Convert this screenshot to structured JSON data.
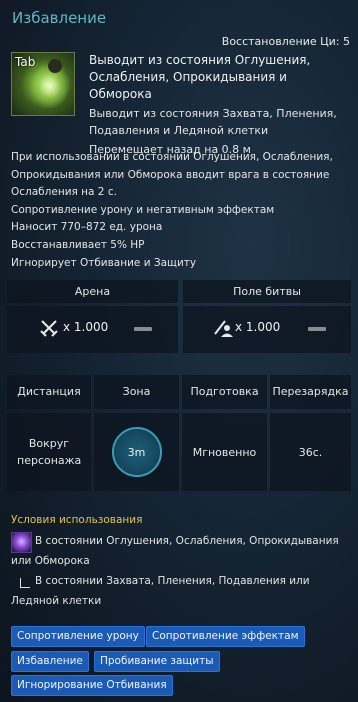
{
  "skill": {
    "title": "Избавление",
    "recovery": "Восстановление Ци: 5",
    "hotkey": "Tab",
    "icon": "skill-escape-icon",
    "main_effect": "Выводит из состояния Оглушения, Ослабления, Опрокидывания и Обморока",
    "sub_effect": "Выводит из состояния Захвата, Пленения, Подавления и Ледяной клетки",
    "move_back": "Перемещает назад на 0.8 м"
  },
  "description": [
    "При использовании в состоянии Оглушения, Ослабления, Опрокидывания или Обморока вводит врага в состояние Ослабления на 2 с.",
    "Сопротивление урону и негативным эффектам",
    "Наносит 770–872 ед. урона",
    "Восстанавливает 5% HP",
    "Игнорирует Отбивание и Защиту"
  ],
  "modes": {
    "arena": {
      "label": "Арена",
      "icon": "crossed-swords-icon",
      "multiplier": "x 1.000"
    },
    "battlefield": {
      "label": "Поле битвы",
      "icon": "battlefield-player-icon",
      "multiplier": "x 1.000"
    }
  },
  "stats": {
    "headers": [
      "Дистанция",
      "Зона",
      "Подготовка",
      "Перезарядка"
    ],
    "distance": "Вокруг персонажа",
    "zone": "3m",
    "cast": "Мгновенно",
    "cooldown": "36с."
  },
  "conditions": {
    "title": "Условия использования",
    "icon": "status-condition-icon",
    "primary": "В состоянии Оглушения, Ослабления, Опрокидывания или Обморока",
    "secondary": "В состоянии Захвата, Пленения, Подавления или Ледяной клетки"
  },
  "tags": [
    "Сопротивление урону",
    "Сопротивление эффектам",
    "Избавление",
    "Пробивание защиты",
    "Игнорирование Отбивания"
  ],
  "colors": {
    "title": "#5fb6c6",
    "condition_title": "#e4c24a",
    "tag_bg": "#1c5bb5",
    "zone_ring": "#3a9db5"
  }
}
